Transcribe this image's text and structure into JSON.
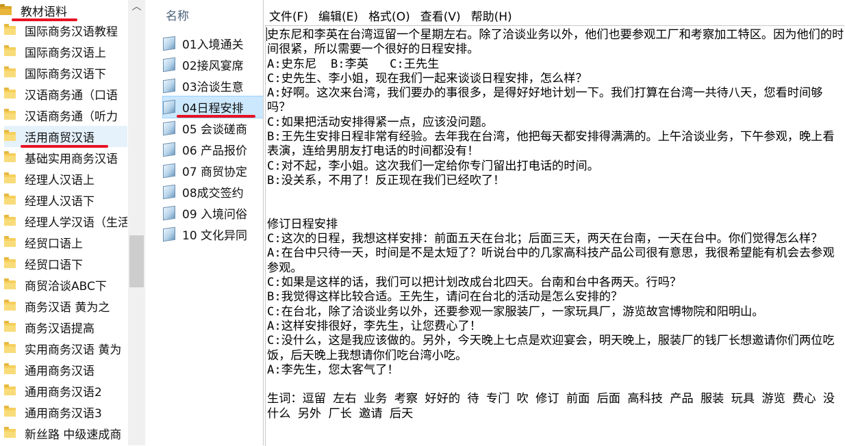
{
  "tree": {
    "root_label": "教材语料",
    "items": [
      "国际商务汉语教程",
      "国际商务汉语上",
      "国际商务汉语下",
      "汉语商务通（口语",
      "汉语商务通（听力",
      "活用商贸汉语",
      "基础实用商务汉语",
      "经理人汉语上",
      "经理人汉语下",
      "经理人学汉语（生活",
      "经贸口语上",
      "经贸口语下",
      "商贸洽谈ABC下",
      "商务汉语 黄为之",
      "商务汉语提高",
      "实用商务汉语 黄为",
      "通用商务汉语",
      "通用商务汉语2",
      "通用商务汉语3",
      "新丝路 中级速成商"
    ],
    "selected_index": 5
  },
  "files": {
    "header": "名称",
    "items": [
      "01入境通关",
      "02接风宴席",
      "03洽谈生意",
      "04日程安排",
      "05 会谈磋商",
      "06 产品报价",
      "07 商贸协定",
      "08成交签约",
      "09 入境问俗",
      "10 文化异同"
    ],
    "selected_index": 3
  },
  "notepad": {
    "menu": [
      "文件(F)",
      "编辑(E)",
      "格式(O)",
      "查看(V)",
      "帮助(H)"
    ],
    "text": "史东尼和李英在台湾逗留一个星期左右。除了洽谈业务以外，他们也要参观工厂和考察加工特区。因为他们的时间很紧，所以需要一个很好的日程安排。\nA:史东尼  B:李英   C:王先生\nC:史先生、李小姐，现在我们一起来谈谈日程安排，怎么样？\nA:好啊。这次来台湾，我们要办的事很多，是得好好地计划一下。我们打算在台湾一共待八天，您看时间够吗？\nC:如果把活动安排得紧一点，应该没问题。\nB:王先生安排日程非常有经验。去年我在台湾，他把每天都安排得满满的。上午洽谈业务，下午参观，晚上看表演，连给男朋友打电话的时间都没有！\nC:对不起，李小姐。这次我们一定给你专门留出打电话的时间。\nB:没关系，不用了！反正现在我们已经吹了！\n\n\n修订日程安排\nC:这次的日程，我想这样安排：前面五天在台北；后面三天，两天在台南，一天在台中。你们觉得怎么样？\nA:在台中只待一天，时间是不是太短了？听说台中的几家高科技产品公司很有意思，我很希望能有机会去参观参观。\nC:如果是这样的话，我们可以把计划改成台北四天。台南和台中各两天。行吗？\nB:我觉得这样比较合适。王先生，请问在台北的活动是怎么安排的？\nC:在台北，除了洽谈业务以外，还要参观一家服装厂，一家玩具厂，游览故宫博物院和阳明山。\nA:这样安排很好，李先生，让您费心了！\nC:没什么，这是我应该做的。另外，今天晚上七点是欢迎宴会，明天晚上，服装厂的钱厂长想邀请你们两位吃饭，后天晚上我想请你们吃台湾小吃。\nA:李先生，您太客气了！\n\n生词：逗留 左右 业务 考察 好好的 待 专门 吹 修订 前面 后面 高科技 产品 服装 玩具 游览 费心 没什么 另外 厂长 邀请 后天"
  },
  "colors": {
    "annotation": "#e81123",
    "selection": "#cce8ff",
    "folder": "#f6cf5d"
  }
}
